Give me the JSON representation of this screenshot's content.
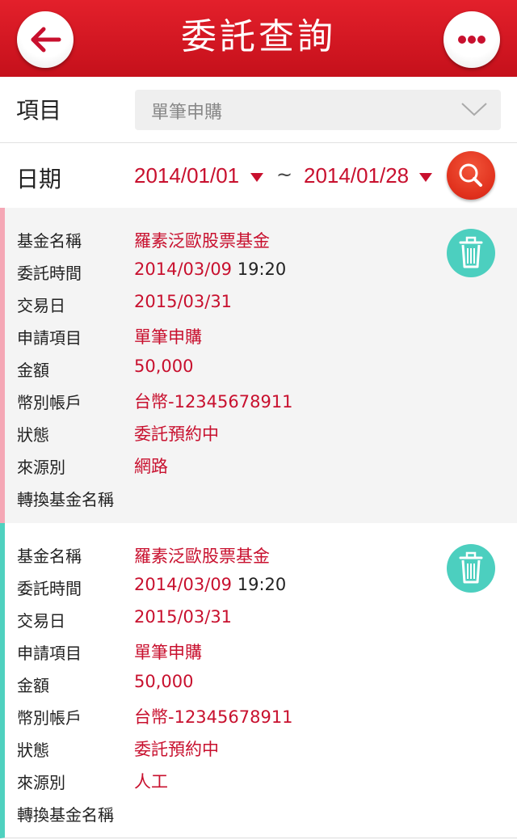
{
  "header": {
    "title": "委託查詢",
    "back_icon": "back-arrow-icon",
    "more_icon": "more-dots-icon"
  },
  "filter": {
    "item_label": "項目",
    "item_value": "單筆申購",
    "date_label": "日期",
    "date_from": "2014/01/01",
    "date_separator": "~",
    "date_to": "2014/01/28",
    "search_icon": "search-icon"
  },
  "labels": {
    "fund_name": "基金名稱",
    "order_time": "委託時間",
    "trade_date": "交易日",
    "apply_item": "申請項目",
    "amount": "金額",
    "account": "幣別帳戶",
    "status": "狀態",
    "source": "來源別",
    "switch_fund": "轉換基金名稱"
  },
  "orders": [
    {
      "fund_name": "羅素泛歐股票基金",
      "order_date": "2014/03/09",
      "order_time": "19:20",
      "trade_date": "2015/03/31",
      "apply_item": "單筆申購",
      "amount": "50,000",
      "account": "台幣-12345678911",
      "status": "委託預約中",
      "source": "網路",
      "switch_fund": ""
    },
    {
      "fund_name": "羅素泛歐股票基金",
      "order_date": "2014/03/09",
      "order_time": "19:20",
      "trade_date": "2015/03/31",
      "apply_item": "單筆申購",
      "amount": "50,000",
      "account": "台幣-12345678911",
      "status": "委託預約中",
      "source": "人工",
      "switch_fund": ""
    }
  ],
  "colors": {
    "brand_red": "#c8102e",
    "header_red": "#d81824",
    "accent_teal": "#4ccfbf",
    "card1_bar": "#f5a7b5",
    "card2_bar": "#4fd1bf"
  }
}
